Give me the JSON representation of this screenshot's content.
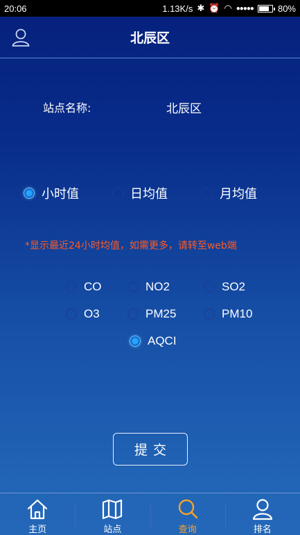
{
  "status_bar": {
    "time": "20:06",
    "network_speed": "1.13K/s",
    "signal": "●●●●●",
    "battery": "80%",
    "battery_level": 0.8
  },
  "header": {
    "title": "北辰区",
    "user_icon": "user-icon"
  },
  "station": {
    "label": "站点名称:",
    "value": "北辰区"
  },
  "period_options": [
    {
      "label": "小时值",
      "selected": true
    },
    {
      "label": "日均值",
      "selected": false
    },
    {
      "label": "月均值",
      "selected": false
    }
  ],
  "notice": "*显示最近24小时均值，如需更多，请转至web端",
  "pollutants": [
    {
      "label": "CO",
      "selected": false
    },
    {
      "label": "NO2",
      "selected": false
    },
    {
      "label": "SO2",
      "selected": false
    },
    {
      "label": "O3",
      "selected": false
    },
    {
      "label": "PM25",
      "selected": false
    },
    {
      "label": "PM10",
      "selected": false
    },
    {
      "label": "AQCI",
      "selected": true
    }
  ],
  "submit_label": "提交",
  "bottom_nav": [
    {
      "label": "主页",
      "icon": "home-icon",
      "active": false
    },
    {
      "label": "站点",
      "icon": "map-icon",
      "active": false
    },
    {
      "label": "查询",
      "icon": "search-icon",
      "active": true
    },
    {
      "label": "排名",
      "icon": "user-icon",
      "active": false
    }
  ],
  "colors": {
    "notice": "#ff5a22",
    "active_nav": "#f7a22a",
    "radio_checked": "#2aa3ff"
  }
}
